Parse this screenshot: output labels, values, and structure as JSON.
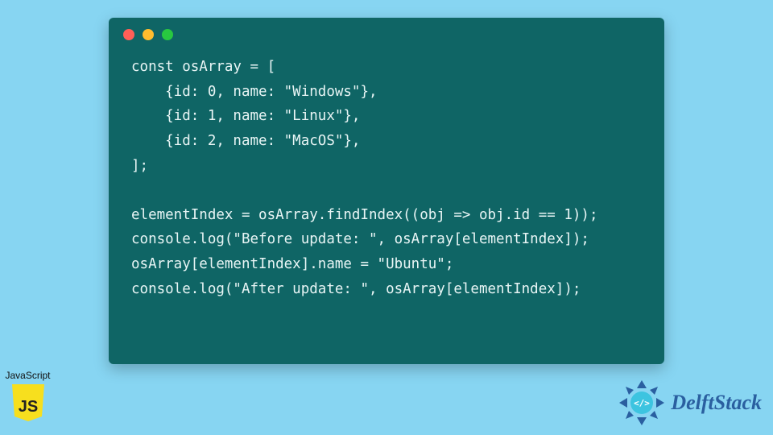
{
  "code": {
    "lines": [
      "const osArray = [",
      "    {id: 0, name: \"Windows\"},",
      "    {id: 1, name: \"Linux\"},",
      "    {id: 2, name: \"MacOS\"},",
      "];",
      "",
      "elementIndex = osArray.findIndex((obj => obj.id == 1));",
      "console.log(\"Before update: \", osArray[elementIndex]);",
      "osArray[elementIndex].name = \"Ubuntu\";",
      "console.log(\"After update: \", osArray[elementIndex]);"
    ]
  },
  "js_badge": {
    "label": "JavaScript",
    "shield_text": "JS"
  },
  "brand": {
    "name": "DelftStack"
  },
  "colors": {
    "background": "#87d5f2",
    "window": "#0f6565",
    "code_text": "#e8f5f5",
    "js_shield": "#f7df1e",
    "brand_text": "#2a5fa0"
  }
}
